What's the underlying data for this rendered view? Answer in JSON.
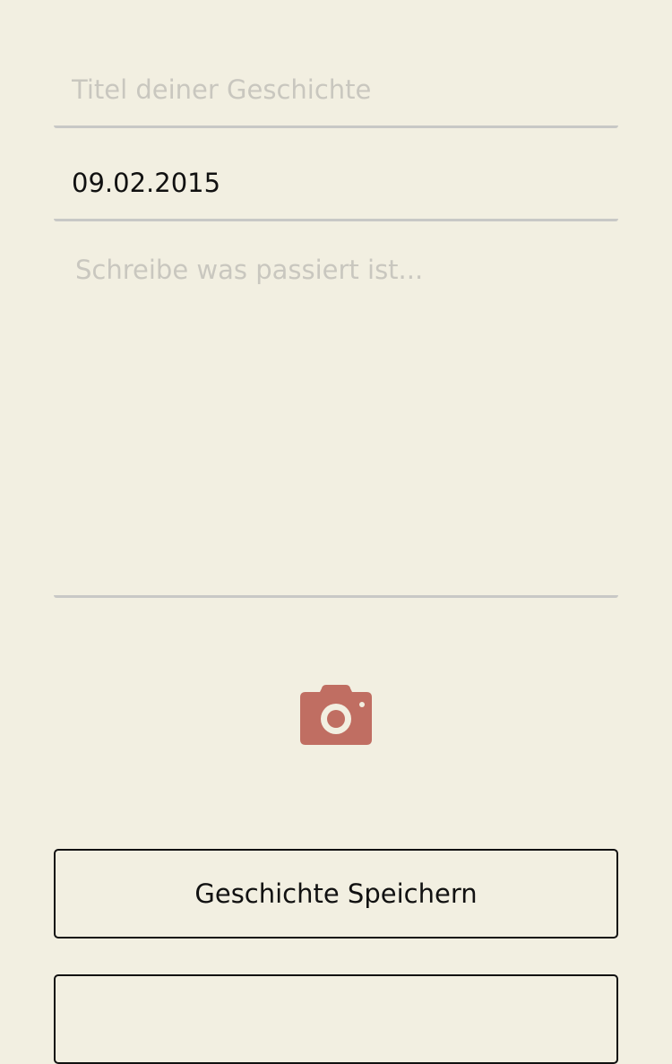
{
  "form": {
    "title_placeholder": "Titel deiner Geschichte",
    "title_value": "",
    "date_value": "09.02.2015",
    "story_placeholder": "Schreibe was passiert ist...",
    "story_value": ""
  },
  "camera": {
    "icon": "camera-icon",
    "color": "#c06e62"
  },
  "actions": {
    "save_label": "Geschichte Speichern",
    "second_label": ""
  },
  "colors": {
    "background": "#f2efe1",
    "field_underline": "#c8c8c6",
    "placeholder": "#c9c7bf",
    "accent": "#c06e62",
    "text": "#111111"
  }
}
